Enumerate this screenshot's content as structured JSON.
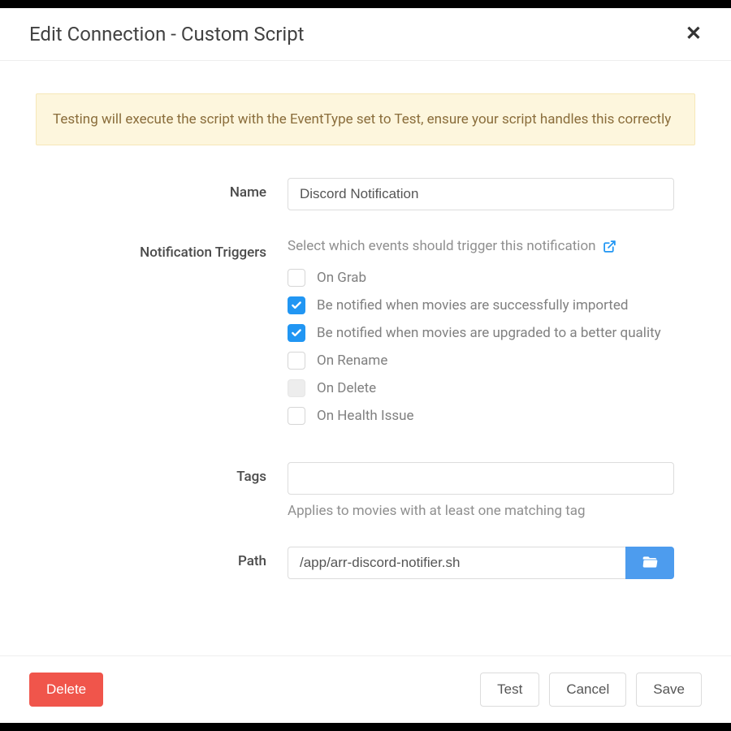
{
  "header": {
    "title": "Edit Connection - Custom Script"
  },
  "alert": "Testing will execute the script with the EventType set to Test, ensure your script handles this correctly",
  "form": {
    "name": {
      "label": "Name",
      "value": "Discord Notification"
    },
    "triggers": {
      "label": "Notification Triggers",
      "help": "Select which events should trigger this notification",
      "items": [
        {
          "label": "On Grab",
          "checked": false,
          "disabled": false
        },
        {
          "label": "Be notified when movies are successfully imported",
          "checked": true,
          "disabled": false
        },
        {
          "label": "Be notified when movies are upgraded to a better quality",
          "checked": true,
          "disabled": false
        },
        {
          "label": "On Rename",
          "checked": false,
          "disabled": false
        },
        {
          "label": "On Delete",
          "checked": false,
          "disabled": true
        },
        {
          "label": "On Health Issue",
          "checked": false,
          "disabled": false
        }
      ]
    },
    "tags": {
      "label": "Tags",
      "value": "",
      "help": "Applies to movies with at least one matching tag"
    },
    "path": {
      "label": "Path",
      "value": "/app/arr-discord-notifier.sh"
    }
  },
  "footer": {
    "delete": "Delete",
    "test": "Test",
    "cancel": "Cancel",
    "save": "Save"
  }
}
